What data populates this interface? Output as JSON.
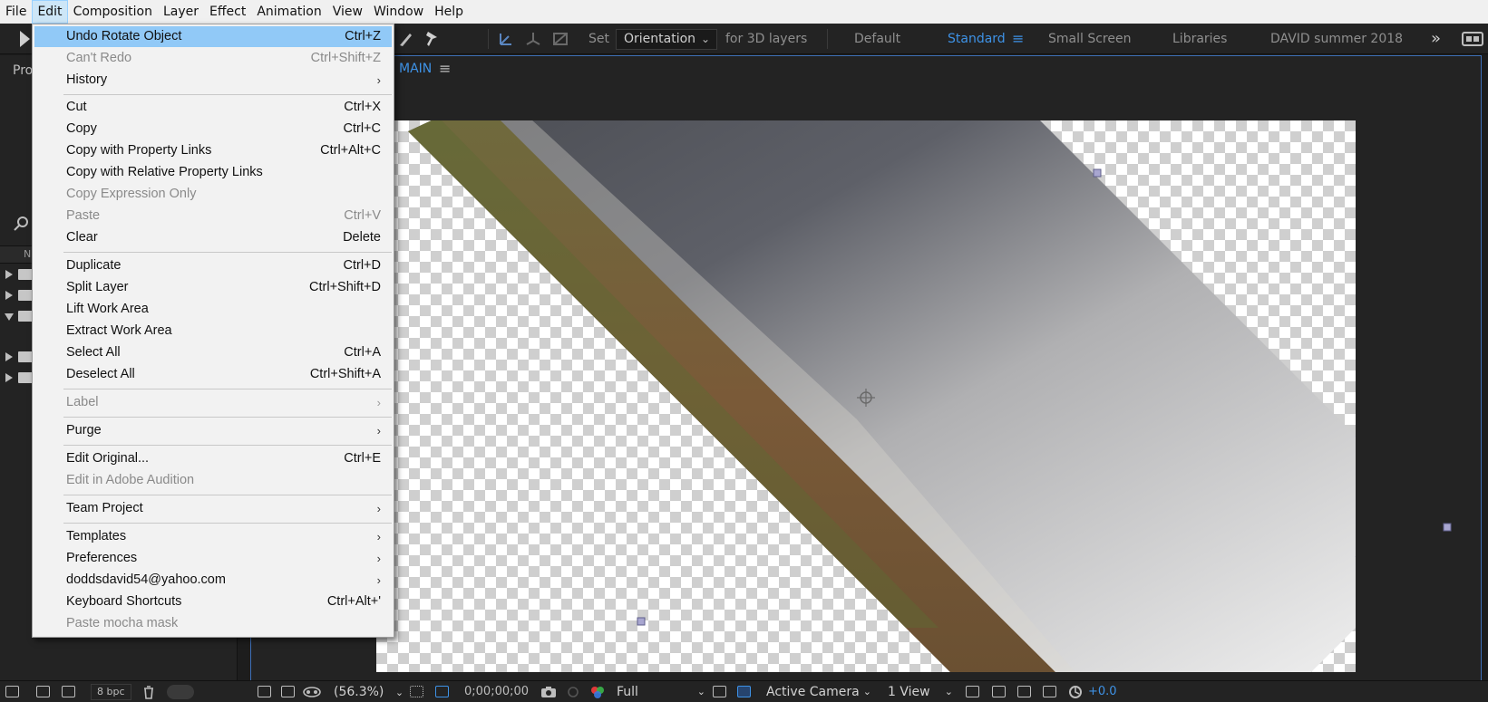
{
  "menubar": {
    "items": [
      "File",
      "Edit",
      "Composition",
      "Layer",
      "Effect",
      "Animation",
      "View",
      "Window",
      "Help"
    ],
    "active": "Edit"
  },
  "toolbar": {
    "set_label": "Set",
    "orientation_value": "Orientation",
    "for3d_label": "for 3D layers",
    "workspaces": [
      "Default",
      "Standard",
      "Small Screen",
      "Libraries",
      "DAVID summer 2018"
    ],
    "active_workspace": "Standard"
  },
  "left_panel": {
    "project_tab": "Pro",
    "name_col": "N",
    "bpc": "8 bpc"
  },
  "comp_panel": {
    "tab_label": "MAIN"
  },
  "bottom_bar": {
    "zoom": "(56.3%)",
    "timecode": "0;00;00;00",
    "resolution": "Full",
    "camera": "Active Camera",
    "views": "1 View",
    "exposure": "+0.0"
  },
  "edit_menu": {
    "items": [
      {
        "label": "Undo Rotate Object",
        "shortcut": "Ctrl+Z",
        "state": "highlighted"
      },
      {
        "label": "Can't Redo",
        "shortcut": "Ctrl+Shift+Z",
        "state": "disabled"
      },
      {
        "label": "History",
        "submenu": true
      },
      {
        "label": "Cut",
        "shortcut": "Ctrl+X"
      },
      {
        "label": "Copy",
        "shortcut": "Ctrl+C"
      },
      {
        "label": "Copy with Property Links",
        "shortcut": "Ctrl+Alt+C"
      },
      {
        "label": "Copy with Relative Property Links"
      },
      {
        "label": "Copy Expression Only",
        "state": "disabled"
      },
      {
        "label": "Paste",
        "shortcut": "Ctrl+V",
        "state": "disabled"
      },
      {
        "label": "Clear",
        "shortcut": "Delete"
      },
      {
        "label": "Duplicate",
        "shortcut": "Ctrl+D"
      },
      {
        "label": "Split Layer",
        "shortcut": "Ctrl+Shift+D"
      },
      {
        "label": "Lift Work Area"
      },
      {
        "label": "Extract Work Area"
      },
      {
        "label": "Select All",
        "shortcut": "Ctrl+A"
      },
      {
        "label": "Deselect All",
        "shortcut": "Ctrl+Shift+A"
      },
      {
        "label": "Label",
        "submenu": true,
        "state": "disabled"
      },
      {
        "label": "Purge",
        "submenu": true
      },
      {
        "label": "Edit Original...",
        "shortcut": "Ctrl+E"
      },
      {
        "label": "Edit in Adobe Audition",
        "state": "disabled"
      },
      {
        "label": "Team Project",
        "submenu": true
      },
      {
        "label": "Templates",
        "submenu": true
      },
      {
        "label": "Preferences",
        "submenu": true
      },
      {
        "label": "doddsdavid54@yahoo.com",
        "submenu": true
      },
      {
        "label": "Keyboard Shortcuts",
        "shortcut": "Ctrl+Alt+'"
      },
      {
        "label": "Paste mocha mask",
        "state": "disabled"
      }
    ],
    "submenu_arrow": "›"
  }
}
